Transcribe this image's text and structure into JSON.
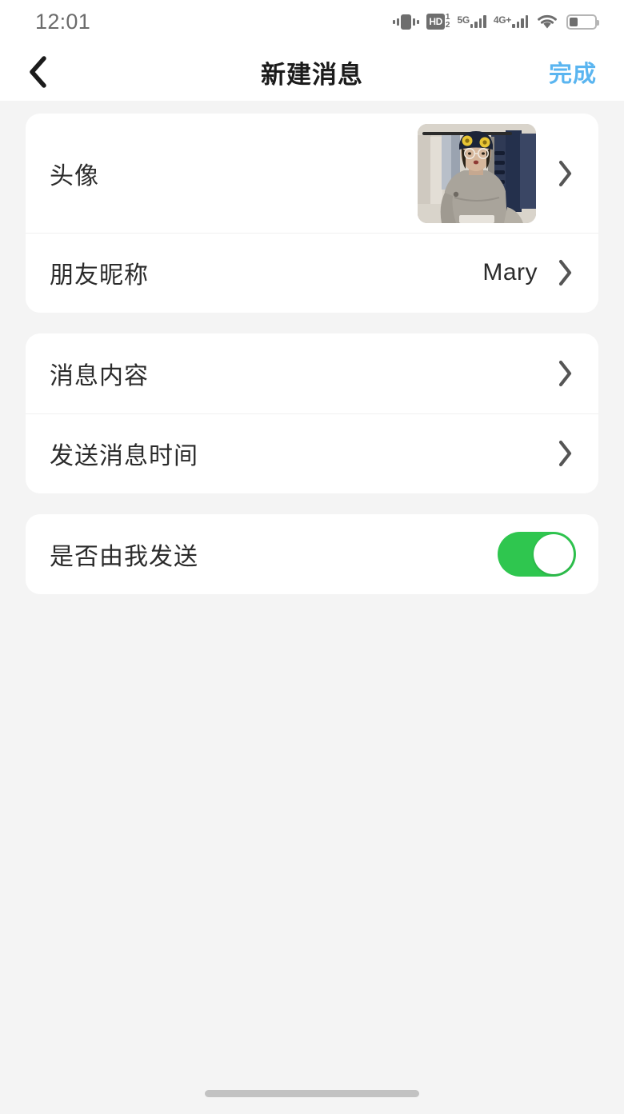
{
  "status_bar": {
    "time": "12:01",
    "icons": [
      {
        "name": "vibrate-icon",
        "label": "vibrate"
      },
      {
        "name": "hd-call-icon",
        "label": "HD",
        "superscript": "1",
        "subscript": "2"
      },
      {
        "name": "signal-5g-icon",
        "network": "5G",
        "bars": 4
      },
      {
        "name": "signal-4g-plus-icon",
        "network": "4G+",
        "bars": 4
      },
      {
        "name": "wifi-icon",
        "label": "wifi"
      },
      {
        "name": "battery-icon",
        "label": "battery",
        "level_percent": 32
      }
    ]
  },
  "nav": {
    "back_label": "<",
    "title": "新建消息",
    "action_label": "完成",
    "action_color": "#5ab5f0"
  },
  "cards": [
    {
      "id": "profile-card",
      "rows": [
        {
          "name": "avatar-row",
          "label": "头像",
          "type": "image",
          "value": "",
          "has_chevron": true
        },
        {
          "name": "nickname-row",
          "label": "朋友昵称",
          "type": "text",
          "value": "Mary",
          "has_chevron": true
        }
      ]
    },
    {
      "id": "message-card",
      "rows": [
        {
          "name": "message-content-row",
          "label": "消息内容",
          "type": "text",
          "value": "",
          "has_chevron": true
        },
        {
          "name": "send-time-row",
          "label": "发送消息时间",
          "type": "text",
          "value": "",
          "has_chevron": true
        }
      ]
    },
    {
      "id": "sender-card",
      "rows": [
        {
          "name": "sent-by-me-row",
          "label": "是否由我发送",
          "type": "toggle",
          "value": "on",
          "has_chevron": false
        }
      ]
    }
  ],
  "toggle": {
    "sent_by_me_on": "true",
    "on_color": "#2fc64f",
    "off_color": "#dcdcdc"
  },
  "theme": {
    "page_background": "#f4f4f4",
    "card_background": "#ffffff",
    "primary_text": "#2b2b2b",
    "title_text": "#1b1b1b",
    "status_text": "#6b6b6b",
    "chevron_color": "#555555",
    "divider": "#f0f0f0",
    "home_indicator": "#c2c2c2"
  }
}
